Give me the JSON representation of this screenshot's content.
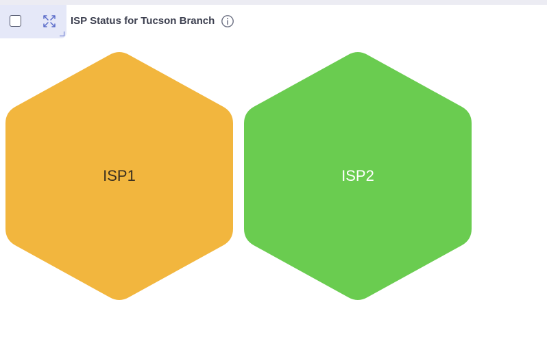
{
  "header": {
    "title": "ISP Status for Tucson Branch"
  },
  "icons": {
    "checkbox": "checkbox-icon",
    "expand": "expand-icon",
    "info": "info-icon"
  },
  "isps": [
    {
      "label": "ISP1",
      "status_color": "#f2b63e",
      "text_color": "#3b3020"
    },
    {
      "label": "ISP2",
      "status_color": "#6acc50",
      "text_color": "#ffffff"
    }
  ]
}
